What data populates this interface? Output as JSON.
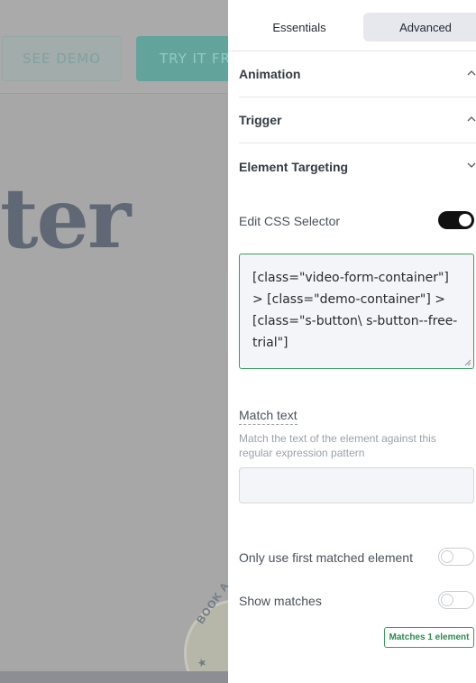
{
  "background": {
    "buttons": {
      "demo": "SEE DEMO",
      "trial": "TRY IT FR"
    },
    "heading_fragment": "ter",
    "badge_text_1": "BOOK A",
    "badge_text_2": "N ★"
  },
  "panel": {
    "tabs": [
      {
        "label": "Essentials",
        "active": false
      },
      {
        "label": "Advanced",
        "active": true
      }
    ],
    "sections": {
      "animation": {
        "label": "Animation",
        "icon": "chevron-up-icon"
      },
      "trigger": {
        "label": "Trigger",
        "icon": "chevron-up-icon"
      },
      "element_targeting": {
        "label": "Element Targeting",
        "icon": "chevron-down-icon"
      }
    },
    "edit_css_selector": {
      "label": "Edit CSS Selector",
      "enabled": true
    },
    "css_selector_value": "[class=\"video-form-container\"] > [class=\"demo-container\"] > [class=\"s-button\\ s-button--free-trial\"]",
    "match_text": {
      "label": "Match text",
      "help": "Match the text of the element against this regular expression pattern",
      "value": ""
    },
    "only_first": {
      "label": "Only use first matched element",
      "enabled": false
    },
    "show_matches": {
      "label": "Show matches",
      "enabled": false
    },
    "matches_badge": "Matches 1 element"
  },
  "colors": {
    "accent_green": "#3b9d5d",
    "toggle_on": "#111111",
    "tab_active_bg": "#e6e8ee"
  }
}
